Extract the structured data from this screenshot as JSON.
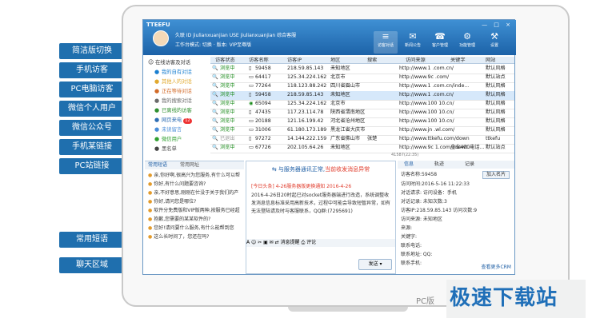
{
  "callouts": [
    "简洁版切换",
    "手机访客",
    "PC电脑访客",
    "微信个人用户",
    "微信公众号",
    "手机某链接",
    "PC站链接",
    "常用短语",
    "聊天区域"
  ],
  "app": {
    "brand": "TTEEFU",
    "user_line": "久联 ID jiulianxuanjian USE jiulianxuanjian 综合客服",
    "mode_line": "工作台模式: 切换 · 版本: VIP至尊版",
    "window_controls": "— □ ×",
    "toolbar": [
      {
        "icon": "≡",
        "label": "访客对话"
      },
      {
        "icon": "✉",
        "label": "新闻公告"
      },
      {
        "icon": "☎",
        "label": "客户管理"
      },
      {
        "icon": "⚙",
        "label": "功能管理"
      },
      {
        "icon": "⚒",
        "label": "设置"
      }
    ]
  },
  "tree": [
    {
      "icon": "☺",
      "label": "在线访客及对话"
    },
    {
      "icon": "●",
      "label": "我的自有对话"
    },
    {
      "icon": "●",
      "label": "其他人的对话"
    },
    {
      "icon": "●",
      "label": "正在等待对话"
    },
    {
      "icon": "●",
      "label": "我的搜索对话"
    },
    {
      "icon": "●",
      "label": "已离线的访客"
    },
    {
      "icon": "●",
      "label": "网页来电",
      "badge": "12"
    },
    {
      "icon": "●",
      "label": "未读留言"
    },
    {
      "icon": "●",
      "label": "微信用户"
    },
    {
      "icon": "●",
      "label": "黑名单"
    }
  ],
  "table": {
    "headers": [
      "访客状态",
      "访客名称",
      "访客IP",
      "地区",
      "搜索",
      "访问来源",
      "关键字",
      "网站"
    ],
    "rows": [
      [
        "浏览中",
        "59458",
        "218.59.85.143",
        "未知地区",
        "",
        "http://www.1 .com.cn/",
        "",
        "默认风格"
      ],
      [
        "浏览中",
        "64417",
        "125.34.224.162",
        "北京市",
        "",
        "http://www.9c .com/",
        "",
        "默认站点"
      ],
      [
        "浏览中",
        "77264",
        "118.123.88.242",
        "四川省眉山市",
        "",
        "http://www.1 .com.cn/inde...",
        "",
        "默认风格"
      ],
      [
        "浏览中",
        "59458",
        "218.59.85.143",
        "未知地区",
        "",
        "http://www.1 .com.cn/",
        "",
        "默认风格"
      ],
      [
        "浏览中",
        "65094",
        "125.34.224.162",
        "北京市",
        "",
        "http://www.100 10.cn/",
        "",
        "默认风格"
      ],
      [
        "浏览中",
        "47435",
        "117.23.114.78",
        "陕西省渭南地区",
        "",
        "http://www.100 10.cn/",
        "",
        "默认风格"
      ],
      [
        "浏览中",
        "20188",
        "121.16.199.42",
        "河北省沧州地区",
        "",
        "http://www.100 10.cn/",
        "",
        "默认风格"
      ],
      [
        "浏览中",
        "31006",
        "61.180.173.189",
        "黑龙江省大庆市",
        "",
        "http://www.jn .wl.com/",
        "",
        "默认风格"
      ],
      [
        "已退出",
        "97272",
        "14.144.222.159",
        "广东省佛山市",
        "张楚",
        "http://www.ttkefu.com/down",
        "",
        "ttkefu"
      ],
      [
        "浏览中",
        "67726",
        "202.105.64.26",
        "未知地区",
        "",
        "http://www.9c 1.com/3newt...",
        "全业400电话...",
        "默认站点"
      ]
    ],
    "footer_note": "41587(22:35)"
  },
  "phrases": {
    "tabs": [
      "常用短语",
      "常用网址"
    ],
    "items": [
      "亲,你好啊,很高兴为您服务,有什么可以帮",
      "你好,有什么问题要咨询?",
      "亲,不好意思,刚刚在忙没于关于我们的产",
      "你好,请问您是哪位?",
      "软件分免费版和VIP版两种,按服务已经超",
      "抱歉,您需要的某某软件的?",
      "您好!请问要什么服务,有什么能帮到您",
      "这么长时间了，您还在吗?"
    ]
  },
  "chat": {
    "status_prefix": "与服务器通讯正常,",
    "status_warn": "当前收发消息异常",
    "msg_head": "[今日头条] 4-26服务器版更换通知 2016-4-26",
    "msg_body": "2016-4-26日20时起已对socket服务器端进行改造，系统调整收发消息信息标准采用高新技术，过程中可能会导致短暂异常，如有无法登陆请及时与客服联系，QQ群:(7295691)",
    "toolbar": "A ☺ ✂ ▣ ✉ ⇄ 消息提醒 ⎙ 评论",
    "send": "发送 ▾"
  },
  "visitor": {
    "tabs": [
      "信息",
      "轨迹",
      "记录"
    ],
    "name_label": "访客名称:59458",
    "add_button": "加入名片",
    "rows": [
      "访问时间:2016-5-16 11:22:33",
      "对话请求: 访问设备：手机",
      "对话记录: 未知次数:3",
      "访客IP:218.59.85.143 访问次数:9",
      "访问来源: 未知地区",
      "来源:",
      "关键字:",
      "联系电话:",
      "联系地址: QQ:",
      "联系手机:"
    ],
    "more_crm": "查看更多CRM"
  },
  "footer": {
    "pc_version": "PC版",
    "watermark": "极速下载站"
  }
}
